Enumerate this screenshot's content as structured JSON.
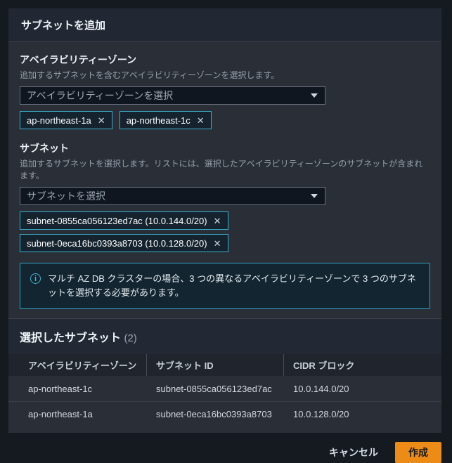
{
  "dialog": {
    "title": "サブネットを追加"
  },
  "az": {
    "label": "アベイラビリティーゾーン",
    "description": "追加するサブネットを含むアベイラビリティーゾーンを選択します。",
    "select_placeholder": "アベイラビリティーゾーンを選択",
    "tags": [
      {
        "label": "ap-northeast-1a"
      },
      {
        "label": "ap-northeast-1c"
      }
    ]
  },
  "subnet": {
    "label": "サブネット",
    "description": "追加するサブネットを選択します。リストには、選択したアベイラビリティーゾーンのサブネットが含まれます。",
    "select_placeholder": "サブネットを選択",
    "tags": [
      {
        "label": "subnet-0855ca056123ed7ac (10.0.144.0/20)"
      },
      {
        "label": "subnet-0eca16bc0393a8703 (10.0.128.0/20)"
      }
    ]
  },
  "info": {
    "text": "マルチ AZ DB クラスターの場合、3 つの異なるアベイラビリティーゾーンで 3 つのサブネットを選択する必要があります。",
    "icon_glyph": "i"
  },
  "selected_subnets": {
    "heading": "選択したサブネット",
    "count": "(2)",
    "columns": {
      "az": "アベイラビリティーゾーン",
      "subnet_id": "サブネット ID",
      "cidr": "CIDR ブロック"
    },
    "rows": [
      {
        "az": "ap-northeast-1c",
        "subnet_id": "subnet-0855ca056123ed7ac",
        "cidr": "10.0.144.0/20"
      },
      {
        "az": "ap-northeast-1a",
        "subnet_id": "subnet-0eca16bc0393a8703",
        "cidr": "10.0.128.0/20"
      }
    ]
  },
  "footer": {
    "cancel_label": "キャンセル",
    "create_label": "作成"
  },
  "icons": {
    "close": "✕"
  },
  "colors": {
    "accent_cyan": "#3bb0cf",
    "primary_orange": "#ec8b16",
    "page_background": "#151a21",
    "card_background": "#2a2f37"
  }
}
